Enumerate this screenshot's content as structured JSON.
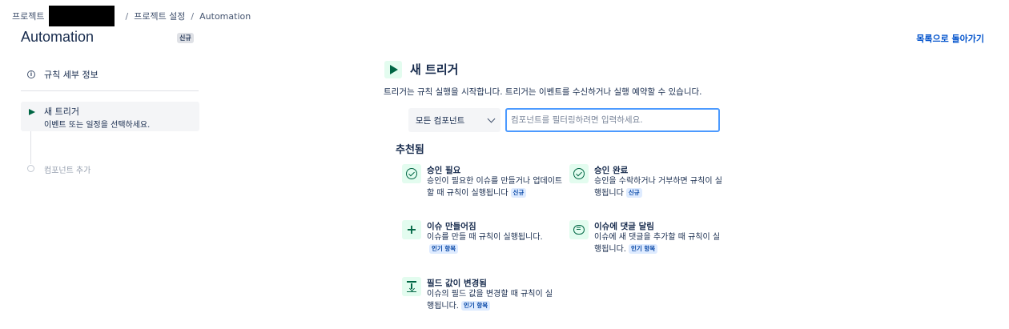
{
  "breadcrumb": {
    "project": "프로젝트",
    "settings": "프로젝트 설정",
    "current": "Automation",
    "separator": "/"
  },
  "header": {
    "title": "Automation",
    "badge": "신규",
    "back_link": "목록으로 돌아가기"
  },
  "steps": {
    "details": "규칙 세부 정보",
    "trigger_title": "새 트리거",
    "trigger_subtitle": "이벤트 또는 일정을 선택하세요.",
    "add_component": "컴포넌트 추가"
  },
  "main": {
    "title": "새 트리거",
    "description": "트리거는 규칙 실행을 시작합니다. 트리거는 이벤트를 수신하거나 실행 예약할 수 있습니다.",
    "select_value": "모든 컴포넌트",
    "filter_placeholder": "컴포넌트를 필터링하려면 입력하세요.",
    "recommended_title": "추천됨"
  },
  "cards": [
    {
      "title": "승인 필요",
      "desc": "승인이 필요한 이슈를 만들거나 업데이트할 때 규칙이 실행됩니다",
      "badge": "신규",
      "icon": "check-circle-icon"
    },
    {
      "title": "승인 완료",
      "desc": "승인을 수락하거나 거부하면 규칙이 실행됩니다",
      "badge": "신규",
      "icon": "check-circle-icon"
    },
    {
      "title": "이슈 만들어짐",
      "desc": "이슈를 만들 때 규칙이 실행됩니다.",
      "badge": "인기 항목",
      "icon": "plus-icon"
    },
    {
      "title": "이슈에 댓글 달림",
      "desc": "이슈에 새 댓글을 추가할 때 규칙이 실행됩니다.",
      "badge": "인기 항목",
      "icon": "comment-icon"
    },
    {
      "title": "필드 값이 변경됨",
      "desc": "이슈의 필드 값을 변경할 때 규칙이 실행됩니다.",
      "badge": "인기 항목",
      "icon": "field-change-icon"
    }
  ],
  "colors": {
    "accent_green": "#006644",
    "link_blue": "#0052cc",
    "focus_border": "#4c9aff",
    "icon_bg": "#e3fcef"
  }
}
